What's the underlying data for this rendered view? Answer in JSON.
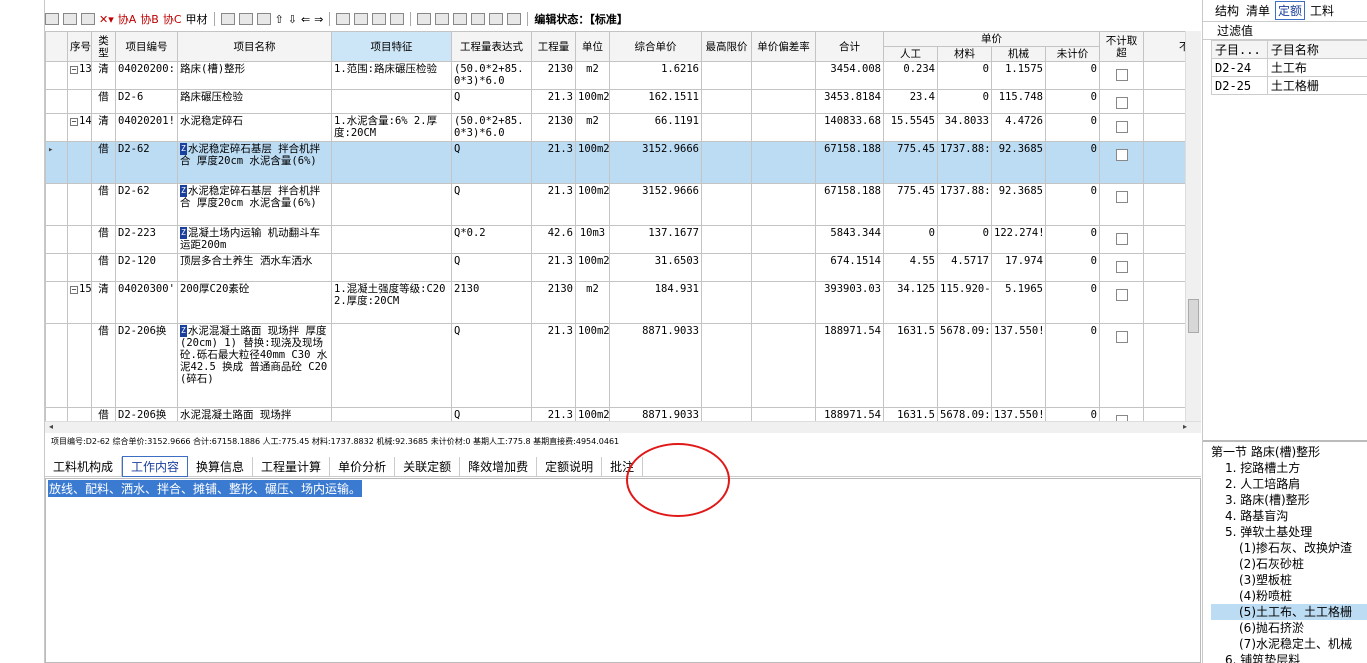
{
  "toolbar": {
    "assoc_a": "协A",
    "assoc_b": "协B",
    "assoc_c": "协C",
    "materials": "甲材",
    "status_label": "编辑状态：【标准】"
  },
  "headers": {
    "seq": "序号",
    "type": "类型",
    "code": "项目编号",
    "name": "项目名称",
    "feature": "项目特征",
    "expr": "工程量表达式",
    "qty": "工程量",
    "unit": "单位",
    "unit_price": "综合单价",
    "max_price": "最高限价",
    "deviation": "单价偏差率",
    "total": "合计",
    "unit_price_group": "单价",
    "labor": "人工",
    "material": "材料",
    "machine": "机械",
    "unpriced": "未计价",
    "no_fee": "不计取超",
    "extra": "不取"
  },
  "rows": [
    {
      "seq": "13",
      "type": "清",
      "code": "04020200:",
      "name": "路床(槽)整形",
      "feature": "1.范围:路床碾压检验",
      "expr": "(50.0*2+85.0*3)*6.0",
      "qty": "2130",
      "unit": "m2",
      "unit_price": "1.6216",
      "total": "3454.008",
      "labor": "0.234",
      "material": "0",
      "machine": "1.1575",
      "unpriced": "0"
    },
    {
      "seq": "",
      "type": "借",
      "code": "D2-6",
      "name": "路床碾压检验",
      "feature": "",
      "expr": "Q",
      "qty": "21.3",
      "unit": "100m2",
      "unit_price": "162.1511",
      "total": "3453.8184",
      "labor": "23.4",
      "material": "0",
      "machine": "115.748",
      "unpriced": "0"
    },
    {
      "seq": "14",
      "type": "清",
      "code": "04020201!",
      "name": "水泥稳定碎石",
      "feature": "1.水泥含量:6% 2.厚度:20CM",
      "expr": "(50.0*2+85.0*3)*6.0",
      "qty": "2130",
      "unit": "m2",
      "unit_price": "66.1191",
      "total": "140833.68",
      "labor": "15.5545",
      "material": "34.8033",
      "machine": "4.4726",
      "unpriced": "0"
    },
    {
      "seq": "",
      "type": "借",
      "code": "D2-62",
      "name": "水泥稳定碎石基层 拌合机拌合 厚度20cm 水泥含量(6%)",
      "feature": "",
      "expr": "Q",
      "qty": "21.3",
      "unit": "100m2",
      "unit_price": "3152.9666",
      "total": "67158.188",
      "labor": "775.45",
      "material": "1737.88:",
      "machine": "92.3685",
      "unpriced": "0"
    },
    {
      "seq": "",
      "type": "借",
      "code": "D2-62",
      "name": "水泥稳定碎石基层 拌合机拌合 厚度20cm 水泥含量(6%)",
      "feature": "",
      "expr": "Q",
      "qty": "21.3",
      "unit": "100m2",
      "unit_price": "3152.9666",
      "total": "67158.188",
      "labor": "775.45",
      "material": "1737.88:",
      "machine": "92.3685",
      "unpriced": "0"
    },
    {
      "seq": "",
      "type": "借",
      "code": "D2-223",
      "name": "混凝土场内运输 机动翻斗车 运距200m",
      "feature": "",
      "expr": "Q*0.2",
      "qty": "42.6",
      "unit": "10m3",
      "unit_price": "137.1677",
      "total": "5843.344",
      "labor": "0",
      "material": "0",
      "machine": "122.274!",
      "unpriced": "0"
    },
    {
      "seq": "",
      "type": "借",
      "code": "D2-120",
      "name": "顶层多合土养生 洒水车洒水",
      "feature": "",
      "expr": "Q",
      "qty": "21.3",
      "unit": "100m2",
      "unit_price": "31.6503",
      "total": "674.1514",
      "labor": "4.55",
      "material": "4.5717",
      "machine": "17.974",
      "unpriced": "0"
    },
    {
      "seq": "15",
      "type": "清",
      "code": "04020300'",
      "name": "200厚C20素砼",
      "feature": "1.混凝土强度等级:C20 2.厚度:20CM",
      "expr": "2130",
      "qty": "2130",
      "unit": "m2",
      "unit_price": "184.931",
      "total": "393903.03",
      "labor": "34.125",
      "material": "115.920-",
      "machine": "5.1965",
      "unpriced": "0"
    },
    {
      "seq": "",
      "type": "借",
      "code": "D2-206换",
      "name": "水泥混凝土路面 现场拌 厚度(20cm) 1) 替换:现浇及现场砼.砾石最大粒径40mm C30 水泥42.5 换成 普通商品砼 C20(碎石)",
      "feature": "",
      "expr": "Q",
      "qty": "21.3",
      "unit": "100m2",
      "unit_price": "8871.9033",
      "total": "188971.54",
      "labor": "1631.5",
      "material": "5678.09:",
      "machine": "137.550!",
      "unpriced": "0"
    },
    {
      "seq": "",
      "type": "借",
      "code": "D2-206换",
      "name": "水泥混凝土路面 现场拌",
      "feature": "",
      "expr": "Q",
      "qty": "21.3",
      "unit": "100m2",
      "unit_price": "8871.9033",
      "total": "188971.54",
      "labor": "1631.5",
      "material": "5678.09:",
      "machine": "137.550!",
      "unpriced": "0"
    }
  ],
  "infobar": "项目编号:D2-62  综合单价:3152.9666  合计:67158.1886  人工:775.45  材料:1737.8832  机械:92.3685  未计价材:0  基期人工:775.8  基期直接费:4954.0461",
  "tabs": [
    "工料机构成",
    "工作内容",
    "换算信息",
    "工程量计算",
    "单价分析",
    "关联定额",
    "降效增加费",
    "定额说明",
    "批注"
  ],
  "active_tab": 1,
  "work_content": "放线、配料、洒水、拌合、摊铺、整形、碾压、场内运输。",
  "right": {
    "tabs": [
      "结构",
      "清单",
      "定额",
      "工料"
    ],
    "active_tab": 2,
    "filter_label": "过滤值",
    "col_code": "子目...",
    "col_name": "子目名称",
    "items": [
      {
        "code": "D2-24",
        "name": "土工布"
      },
      {
        "code": "D2-25",
        "name": "土工格栅"
      }
    ],
    "tree": [
      "第一节 路床(槽)整形",
      "1. 挖路槽土方",
      "2. 人工培路肩",
      "3. 路床(槽)整形",
      "4. 路基盲沟",
      "5. 弹软土基处理",
      "(1)掺石灰、改换炉渣",
      "(2)石灰砂桩",
      "(3)塑板桩",
      "(4)粉喷桩",
      "(5)土工布、土工格栅",
      "(6)抛石挤淤",
      "(7)水泥稳定土、机械",
      "6. 铺筑垫层料"
    ]
  }
}
